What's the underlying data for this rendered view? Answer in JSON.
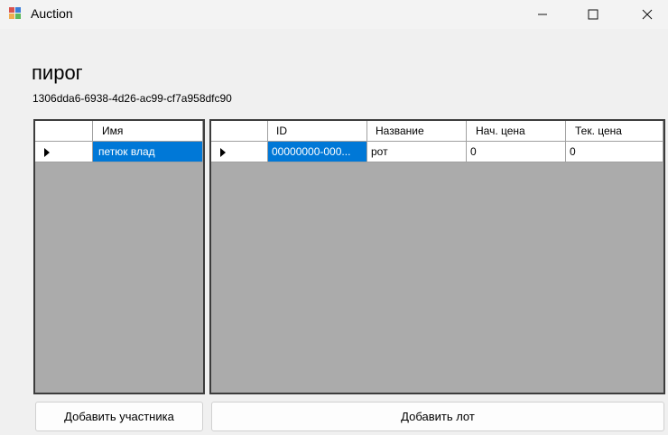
{
  "window": {
    "title": "Auction"
  },
  "page": {
    "title": "пирог",
    "id_text": "1306dda6-6938-4d26-ac99-cf7a958dfc90"
  },
  "participants_grid": {
    "columns": [
      "Имя"
    ],
    "rows": [
      [
        "петюк влад"
      ]
    ]
  },
  "lots_grid": {
    "columns": [
      "ID",
      "Название",
      "Нач. цена",
      "Тек. цена"
    ],
    "rows": [
      [
        "00000000-000...",
        "рот",
        "0",
        "0"
      ]
    ]
  },
  "buttons": {
    "add_participant": "Добавить участника",
    "add_lot": "Добавить лот"
  },
  "colors": {
    "selection": "#0078d7",
    "grid_background": "#ababab"
  }
}
